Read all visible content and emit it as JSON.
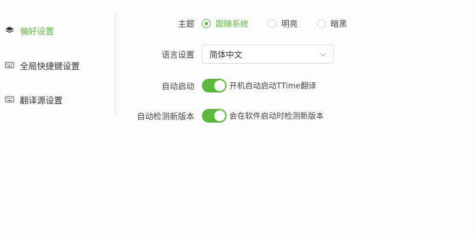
{
  "sidebar": {
    "items": [
      {
        "label": "偏好设置",
        "icon": "layers-icon",
        "active": true
      },
      {
        "label": "全局快捷键设置",
        "icon": "keyboard-icon",
        "active": false
      },
      {
        "label": "翻译源设置",
        "icon": "keyboard-icon",
        "active": false
      }
    ]
  },
  "settings": {
    "theme": {
      "label": "主题",
      "options": [
        {
          "label": "跟随系统",
          "selected": true
        },
        {
          "label": "明亮",
          "selected": false
        },
        {
          "label": "暗黑",
          "selected": false
        }
      ]
    },
    "language": {
      "label": "语言设置",
      "value": "简体中文"
    },
    "autostart": {
      "label": "自动启动",
      "enabled": true,
      "description": "开机自动启动TTime翻译"
    },
    "update_check": {
      "label": "自动检测新版本",
      "enabled": true,
      "description": "会在软件启动时检测新版本"
    }
  },
  "colors": {
    "accent": "#5cb83c",
    "text": "#444444",
    "border": "#dcdcdc"
  }
}
